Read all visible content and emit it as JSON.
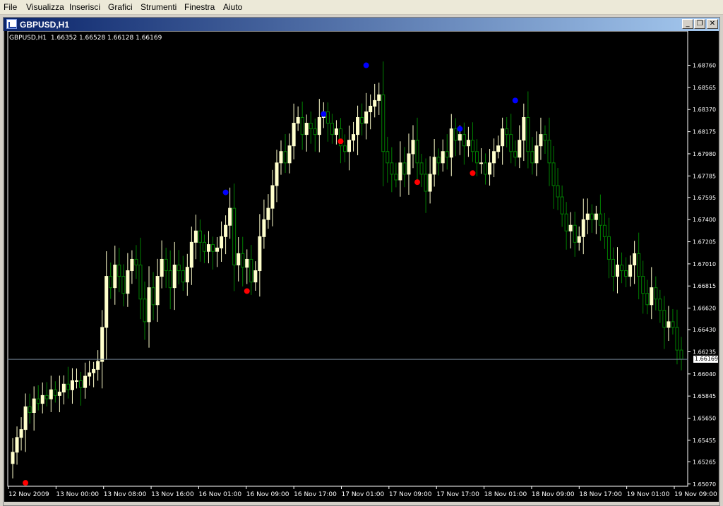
{
  "menu": {
    "items": [
      "File",
      "Visualizza",
      "Inserisci",
      "Grafici",
      "Strumenti",
      "Finestra",
      "Aiuto"
    ]
  },
  "window": {
    "title": "GBPUSD,H1",
    "minimize_glyph": "_",
    "restore_glyph": "❐",
    "close_glyph": "✕"
  },
  "chart_info": "GBPUSD,H1  1.66352 1.66528 1.66128 1.66169",
  "current_price_label": "1.66169",
  "colors": {
    "background": "#000000",
    "bull_candle": "#ffffcc",
    "bear_candle": "#008000",
    "axis": "#ffffff",
    "fractal_up": "#0000ff",
    "fractal_down": "#ff0000",
    "price_line": "#708090"
  },
  "chart_data": {
    "type": "candlestick",
    "symbol": "GBPUSD",
    "timeframe": "H1",
    "y_ticks": [
      "1.68760",
      "1.68565",
      "1.68370",
      "1.68175",
      "1.67980",
      "1.67785",
      "1.67595",
      "1.67400",
      "1.67205",
      "1.67010",
      "1.66815",
      "1.66620",
      "1.66430",
      "1.66235",
      "1.66040",
      "1.65845",
      "1.65650",
      "1.65455",
      "1.65265",
      "1.65070"
    ],
    "x_ticks": [
      "12 Nov 2009",
      "13 Nov 00:00",
      "13 Nov 08:00",
      "13 Nov 16:00",
      "16 Nov 01:00",
      "16 Nov 09:00",
      "16 Nov 17:00",
      "17 Nov 01:00",
      "17 Nov 09:00",
      "17 Nov 17:00",
      "18 Nov 01:00",
      "18 Nov 09:00",
      "18 Nov 17:00",
      "19 Nov 01:00",
      "19 Nov 09:00"
    ],
    "ylim": [
      1.6505,
      1.6895
    ],
    "current_price": 1.66169,
    "closes": [
      1.6535,
      1.6548,
      1.6555,
      1.6575,
      1.657,
      1.6582,
      1.6578,
      1.6585,
      1.6582,
      1.659,
      1.6585,
      1.6588,
      1.6595,
      1.659,
      1.6598,
      1.6598,
      1.6592,
      1.6602,
      1.6605,
      1.6608,
      1.6615,
      1.6645,
      1.669,
      1.668,
      1.67,
      1.669,
      1.6675,
      1.6695,
      1.6705,
      1.67,
      1.667,
      1.665,
      1.668,
      1.6665,
      1.669,
      1.6705,
      1.6695,
      1.668,
      1.67,
      1.6695,
      1.6685,
      1.6698,
      1.672,
      1.673,
      1.672,
      1.6712,
      1.6718,
      1.6712,
      1.6715,
      1.6725,
      1.6735,
      1.675,
      1.67,
      1.671,
      1.6698,
      1.6705,
      1.6685,
      1.6695,
      1.6725,
      1.674,
      1.675,
      1.677,
      1.679,
      1.68,
      1.679,
      1.6805,
      1.6825,
      1.683,
      1.6815,
      1.6825,
      1.682,
      1.6815,
      1.683,
      1.6835,
      1.6825,
      1.6815,
      1.682,
      1.6805,
      1.68,
      1.681,
      1.6815,
      1.683,
      1.6825,
      1.6835,
      1.684,
      1.6845,
      1.685,
      1.68,
      1.679,
      1.678,
      1.6775,
      1.679,
      1.678,
      1.6798,
      1.681,
      1.679,
      1.678,
      1.6765,
      1.678,
      1.6795,
      1.679,
      1.68,
      1.6795,
      1.682,
      1.681,
      1.6815,
      1.6805,
      1.681,
      1.68,
      1.679,
      1.679,
      1.678,
      1.679,
      1.68,
      1.6805,
      1.682,
      1.6815,
      1.68,
      1.6795,
      1.681,
      1.683,
      1.68,
      1.679,
      1.6805,
      1.6815,
      1.681,
      1.679,
      1.677,
      1.676,
      1.6745,
      1.673,
      1.6735,
      1.672,
      1.6725,
      1.674,
      1.6745,
      1.674,
      1.6745,
      1.6735,
      1.6725,
      1.6705,
      1.669,
      1.67,
      1.6695,
      1.669,
      1.67,
      1.671,
      1.669,
      1.6675,
      1.6665,
      1.668,
      1.667,
      1.666,
      1.6645,
      1.665,
      1.6645,
      1.6625,
      1.6617
    ],
    "fractals_up": [
      {
        "bar": 50,
        "price": 1.6764
      },
      {
        "bar": 73,
        "price": 1.6833
      },
      {
        "bar": 83,
        "price": 1.6876
      },
      {
        "bar": 105,
        "price": 1.682
      },
      {
        "bar": 118,
        "price": 1.6845
      }
    ],
    "fractals_down": [
      {
        "bar": 3,
        "price": 1.6508
      },
      {
        "bar": 55,
        "price": 1.6677
      },
      {
        "bar": 77,
        "price": 1.6809
      },
      {
        "bar": 95,
        "price": 1.6773
      },
      {
        "bar": 108,
        "price": 1.6781
      }
    ]
  }
}
